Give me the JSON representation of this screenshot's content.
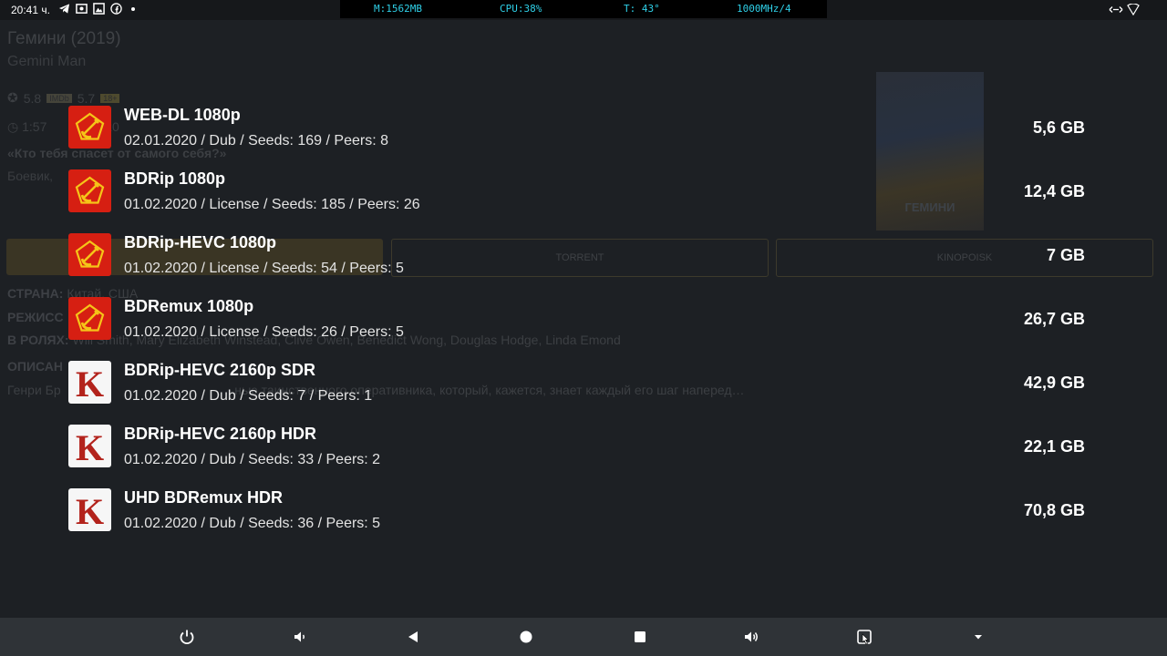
{
  "status_bar": {
    "time": "20:41 ч.",
    "perf": {
      "memory": "M:1562MB",
      "cpu": "CPU:38%",
      "temp": "T: 43°",
      "freq": "1000MHz/4"
    }
  },
  "background": {
    "title": "Гемини (2019)",
    "original_title": "Gemini Man",
    "rating1": "5.8",
    "chip_imdb": "IMDb",
    "rating2": "5.7",
    "chip_age": "18+",
    "runtime": "1:57",
    "year_frag": "20",
    "tagline": "«Кто тебя спасет от самого себя?»",
    "genre": "Боевик,",
    "poster_title": "ГЕМИНИ",
    "btn_torrent": "TORRENT",
    "btn_kino": "KINOPOISK",
    "country_label": "СТРАНА:",
    "country": "Китай, США",
    "director_label": "РЕЖИСС",
    "cast_label": "В РОЛЯХ:",
    "cast": "Will Smith, Mary Elizabeth Winstead, Clive Owen, Benedict Wong, Douglas Hodge, Linda Emond",
    "desc_label": "ОПИСАН",
    "desc": "Генри Бр                                                 нью таинственного оперативника, который, кажется, знает каждый его шаг наперед…"
  },
  "torrents": [
    {
      "title": "WEB-DL 1080p",
      "info": "02.01.2020 / Dub / Seeds: 169 / Peers: 8",
      "size": "5,6 GB",
      "tracker": "rutor"
    },
    {
      "title": "BDRip 1080p",
      "info": "01.02.2020 / License / Seeds: 185 / Peers: 26",
      "size": "12,4 GB",
      "tracker": "rutor"
    },
    {
      "title": "BDRip-HEVC 1080p",
      "info": "01.02.2020 / License / Seeds: 54 / Peers: 5",
      "size": "7 GB",
      "tracker": "rutor"
    },
    {
      "title": "BDRemux 1080p",
      "info": "01.02.2020 / License / Seeds: 26 / Peers: 5",
      "size": "26,7 GB",
      "tracker": "rutor"
    },
    {
      "title": "BDRip-HEVC 2160p SDR",
      "info": "01.02.2020 / Dub / Seeds: 7 / Peers: 1",
      "size": "42,9 GB",
      "tracker": "kinozal"
    },
    {
      "title": "BDRip-HEVC 2160p HDR",
      "info": "01.02.2020 / Dub / Seeds: 33 / Peers: 2",
      "size": "22,1 GB",
      "tracker": "kinozal"
    },
    {
      "title": "UHD BDRemux HDR",
      "info": "01.02.2020 / Dub / Seeds: 36 / Peers: 5",
      "size": "70,8 GB",
      "tracker": "kinozal"
    }
  ],
  "kinozal_letter": "K",
  "icons": {
    "rutor": "hammer-sickle-pentagon-icon",
    "kinozal": "k-letter-icon",
    "nav": [
      "power-icon",
      "volume-down-icon",
      "back-icon",
      "home-icon",
      "recents-icon",
      "volume-up-icon",
      "screenshot-icon",
      "chevron-down-icon"
    ]
  },
  "colors": {
    "rutor_bg": "#d61f12",
    "rutor_symbol": "#f5c518",
    "kinozal_letter": "#b3231c",
    "perf_text": "#2fd0e8"
  }
}
